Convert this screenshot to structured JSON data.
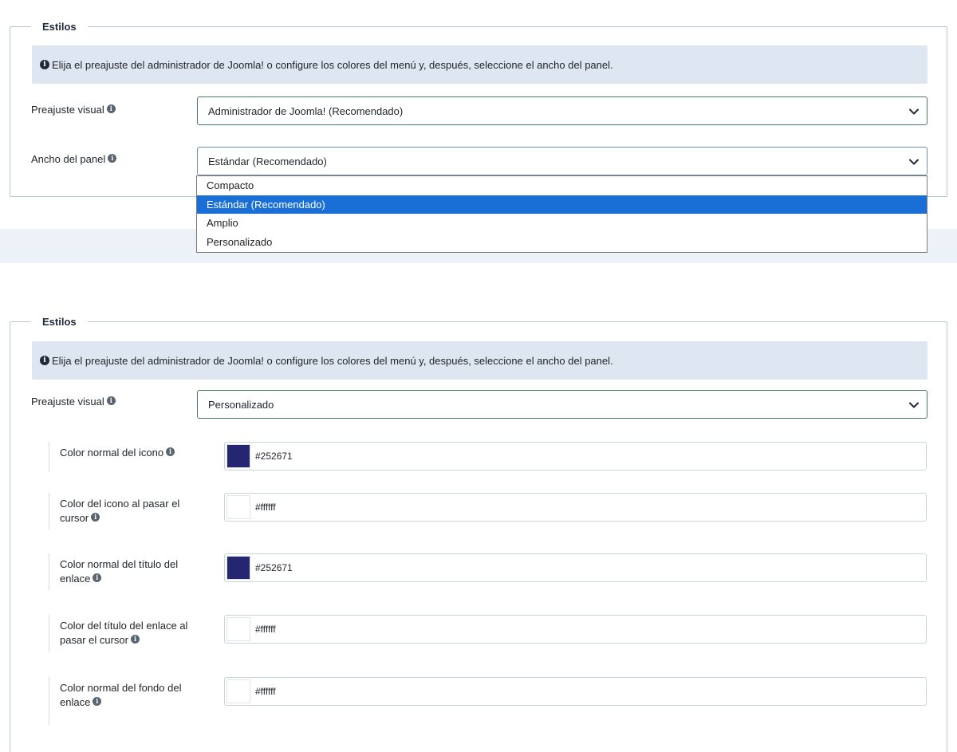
{
  "legend": "Estilos",
  "alert_text": "Elija el preajuste del administrador de Joomla! o configure los colores del menú y, después, seleccione el ancho del panel.",
  "pane1": {
    "preset_label": "Preajuste visual",
    "preset_value": "Administrador de Joomla! (Recomendado)",
    "width_label": "Ancho del panel",
    "width_value": "Estándar (Recomendado)",
    "width_options": [
      "Compacto",
      "Estándar (Recomendado)",
      "Amplio",
      "Personalizado"
    ],
    "selected_option_index": 1
  },
  "pane2": {
    "preset_label": "Preajuste visual",
    "preset_value": "Personalizado",
    "colors": [
      {
        "label": "Color normal del icono",
        "value": "#252671",
        "swatch": "#252671"
      },
      {
        "label": "Color del icono al pasar el cursor",
        "value": "#ffffff",
        "swatch": "#ffffff"
      },
      {
        "label": "Color normal del título del enlace",
        "value": "#252671",
        "swatch": "#252671"
      },
      {
        "label": "Color del título del enlace al pasar el cursor",
        "value": "#ffffff",
        "swatch": "#ffffff"
      },
      {
        "label": "Color normal del fondo del enlace",
        "value": "#ffffff",
        "swatch": "#ffffff"
      }
    ]
  },
  "icons": {
    "info": "info-circle-icon",
    "tooltip": "info-tooltip-icon",
    "chevron": "chevron-down-icon"
  },
  "colors": {
    "selected_option_bg": "#1a6fd6",
    "alert_bg": "#dde6f1",
    "select_border": "#457d54"
  }
}
